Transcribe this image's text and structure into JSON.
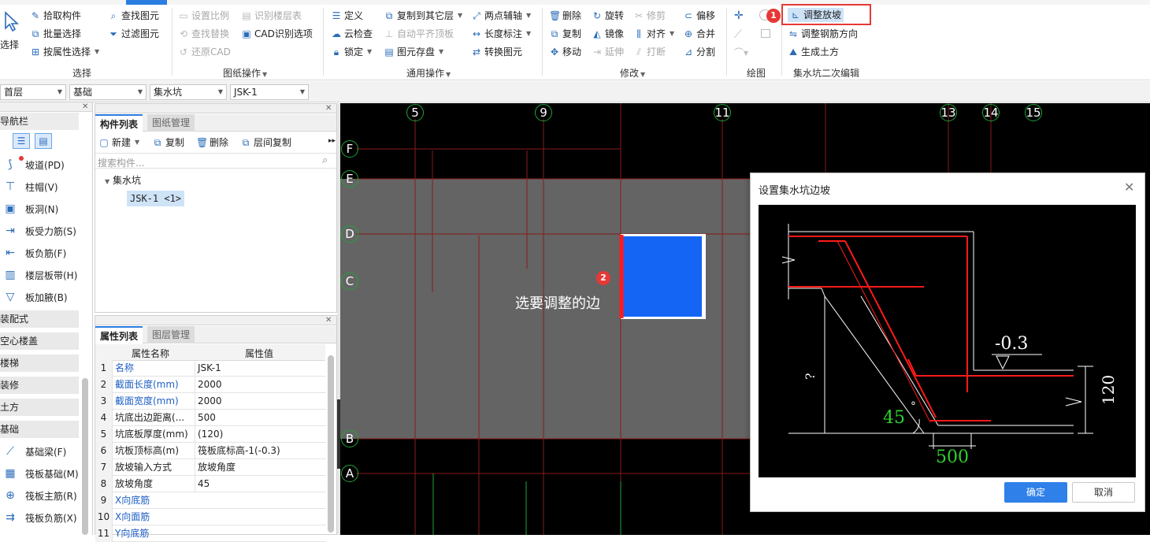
{
  "ribbon": {
    "select_group": {
      "big_button": "选择",
      "pick": "拾取构件",
      "batch_select": "批量选择",
      "select_by_attr": "按属性选择",
      "find_element": "查找图元",
      "filter_element": "过滤图元",
      "label": "选择"
    },
    "drawing_ops": {
      "set_scale": "设置比例",
      "identify_floor_table": "识别楼层表",
      "find_replace": "查找替换",
      "cad_options": "CAD识别选项",
      "restore_cad": "还原CAD",
      "label": "图纸操作"
    },
    "common_ops": {
      "define": "定义",
      "copy_to_floor": "复制到其它层",
      "two_point_axis": "两点辅轴",
      "cloud_check": "云检查",
      "auto_flush_slab": "自动平齐顶板",
      "length_dim": "长度标注",
      "lock": "锁定",
      "element_save": "图元存盘",
      "convert_element": "转换图元",
      "label": "通用操作"
    },
    "modify": {
      "delete": "删除",
      "rotate": "旋转",
      "trim": "修剪",
      "offset": "偏移",
      "copy": "复制",
      "mirror": "镜像",
      "align": "对齐",
      "merge": "合并",
      "move": "移动",
      "extend": "延伸",
      "break": "打断",
      "split": "分割",
      "label": "修改"
    },
    "draw": {
      "label": "绘图"
    },
    "sump_edit": {
      "adjust_slope": "调整放坡",
      "adjust_rebar_dir": "调整钢筋方向",
      "generate_earthwork": "生成土方",
      "label": "集水坑二次编辑"
    },
    "accent": "#e53935"
  },
  "selectors": {
    "floor": "首层",
    "category": "基础",
    "type": "集水坑",
    "component": "JSK-1"
  },
  "nav": {
    "title": "导航栏",
    "items": [
      {
        "label": "坡道(PD)",
        "icon": "ramp-icon"
      },
      {
        "label": "柱帽(V)",
        "icon": "column-cap-icon"
      },
      {
        "label": "板洞(N)",
        "icon": "slab-hole-icon"
      },
      {
        "label": "板受力筋(S)",
        "icon": "slab-rebar-icon"
      },
      {
        "label": "板负筋(F)",
        "icon": "slab-neg-rebar-icon"
      },
      {
        "label": "楼层板带(H)",
        "icon": "slab-strip-icon"
      },
      {
        "label": "板加腋(B)",
        "icon": "slab-haunch-icon"
      }
    ],
    "categories": [
      "装配式",
      "空心楼盖",
      "楼梯",
      "装修",
      "土方",
      "基础"
    ],
    "foundation_items": [
      {
        "label": "基础梁(F)",
        "icon": "foundation-beam-icon"
      },
      {
        "label": "筏板基础(M)",
        "icon": "raft-foundation-icon"
      },
      {
        "label": "筏板主筋(R)",
        "icon": "raft-main-rebar-icon"
      },
      {
        "label": "筏板负筋(X)",
        "icon": "raft-neg-rebar-icon"
      }
    ]
  },
  "component_panel": {
    "tab_active": "构件列表",
    "tab_other": "图纸管理",
    "new": "新建",
    "copy": "复制",
    "delete": "删除",
    "floor_copy": "层间复制",
    "search_placeholder": "搜索构件...",
    "tree_root": "集水坑",
    "tree_item": "JSK-1 <1>"
  },
  "property_panel": {
    "tab_active": "属性列表",
    "tab_other": "图层管理",
    "col_name": "属性名称",
    "col_value": "属性值",
    "rows": [
      {
        "n": "1",
        "k": "名称",
        "v": "JSK-1",
        "blue": true
      },
      {
        "n": "2",
        "k": "截面长度(mm)",
        "v": "2000",
        "blue": true
      },
      {
        "n": "3",
        "k": "截面宽度(mm)",
        "v": "2000",
        "blue": true
      },
      {
        "n": "4",
        "k": "坑底出边距离(...",
        "v": "500",
        "blue": false
      },
      {
        "n": "5",
        "k": "坑底板厚度(mm)",
        "v": "(120)",
        "blue": false
      },
      {
        "n": "6",
        "k": "坑板顶标高(m)",
        "v": "筏板底标高-1(-0.3)",
        "blue": false
      },
      {
        "n": "7",
        "k": "放坡输入方式",
        "v": "放坡角度",
        "blue": false
      },
      {
        "n": "8",
        "k": "放坡角度",
        "v": "45",
        "blue": false
      },
      {
        "n": "9",
        "k": "X向底筋",
        "v": "",
        "blue": true
      },
      {
        "n": "10",
        "k": "X向面筋",
        "v": "",
        "blue": true
      },
      {
        "n": "11",
        "k": "Y向底筋",
        "v": "",
        "blue": true
      }
    ]
  },
  "canvas": {
    "axis_top": [
      "5",
      "9",
      "11",
      "13",
      "14",
      "15"
    ],
    "axis_left": [
      "F",
      "E",
      "D",
      "C",
      "B",
      "A"
    ],
    "hint": "选要调整的边",
    "badge1": "1",
    "badge2": "2"
  },
  "dialog": {
    "title": "设置集水坑边坡",
    "ok": "确定",
    "cancel": "取消",
    "diagram": {
      "elev": "-0.3",
      "thick": "120",
      "unknown": "?",
      "angle": "45",
      "deg": "°",
      "offset": "500"
    }
  }
}
